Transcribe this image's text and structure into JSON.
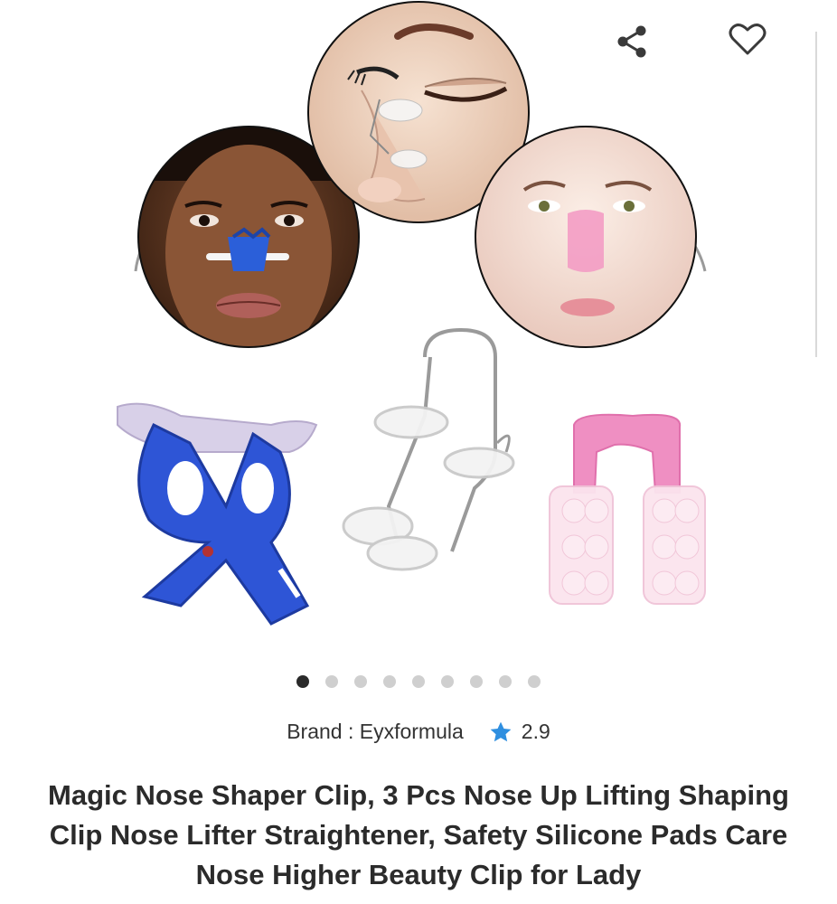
{
  "product": {
    "brand_label": "Brand : Eyxformula",
    "rating": "2.9",
    "title": "Magic Nose Shaper Clip, 3 Pcs Nose Up Lifting Shaping Clip Nose Lifter Straightener, Safety Silicone Pads Care Nose Higher Beauty Clip for Lady"
  },
  "gallery": {
    "image_count": 9,
    "active_index": 0
  },
  "icons": {
    "share": "share-icon",
    "wishlist": "heart-icon",
    "rating": "star-icon"
  },
  "colors": {
    "star": "#2f8fe0",
    "active_dot": "#2a2a2a",
    "inactive_dot": "#cfcfcf",
    "title_text": "#2b2b2b"
  }
}
